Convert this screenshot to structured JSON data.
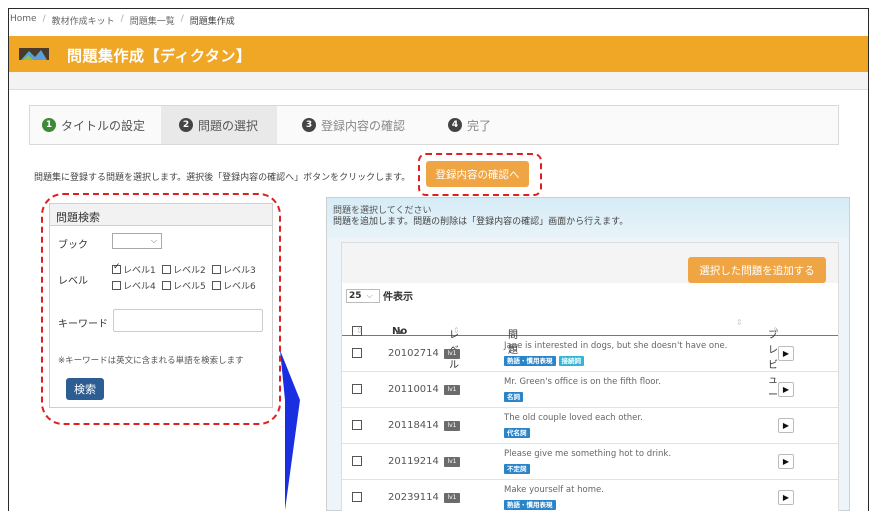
{
  "breadcrumb": [
    "Home",
    "教材作成キット",
    "問題集一覧",
    "問題集作成"
  ],
  "page_title": "問題集作成【ディクタン】",
  "steps": [
    {
      "num": "1",
      "label": "タイトルの設定"
    },
    {
      "num": "2",
      "label": "問題の選択"
    },
    {
      "num": "3",
      "label": "登録内容の確認"
    },
    {
      "num": "4",
      "label": "完了"
    }
  ],
  "instruction": "問題集に登録する問題を選択します。選択後「登録内容の確認へ」ボタンをクリックします。",
  "confirm_button": "登録内容の確認へ",
  "search": {
    "heading": "問題検索",
    "book_label": "ブック",
    "book_caret": "⌵",
    "level_label": "レベル",
    "levels": [
      "レベル1",
      "レベル2",
      "レベル3",
      "レベル4",
      "レベル5",
      "レベル6"
    ],
    "keyword_label": "キーワード",
    "note": "※キーワードは英文に含まれる単語を検索します",
    "button": "検索"
  },
  "right": {
    "line1": "問題を選択してください",
    "line2": "問題を追加します。問題の削除は「登録内容の確認」画面から行えます。",
    "add_button": "選択した問題を追加する",
    "per_page_value": "25",
    "per_page_caret": "⌵",
    "per_page_label": "件表示",
    "columns": {
      "no": "No",
      "level": "レベル",
      "question": "問題",
      "preview": "プレビュー"
    }
  },
  "rows": [
    {
      "no": "20102714",
      "level": "lv1",
      "question": "Jane is interested in dogs, but she doesn't have one.",
      "tags": [
        "熟語・慣用表現",
        "接続詞"
      ]
    },
    {
      "no": "20110014",
      "level": "lv1",
      "question": "Mr. Green's office is on the fifth floor.",
      "tags": [
        "名詞"
      ]
    },
    {
      "no": "20118414",
      "level": "lv1",
      "question": "The old couple loved each other.",
      "tags": [
        "代名詞"
      ]
    },
    {
      "no": "20119214",
      "level": "lv1",
      "question": "Please give me something hot to drink.",
      "tags": [
        "不定詞"
      ]
    },
    {
      "no": "20239114",
      "level": "lv1",
      "question": "Make yourself at home.",
      "tags": [
        "熟語・慣用表現"
      ]
    }
  ],
  "preview_glyph": "▶",
  "colors": {
    "brand": "#f0a725",
    "button_orange": "#f0a545",
    "search_blue": "#2c5d93",
    "annotation_red": "#e02020",
    "arrow_blue": "#1a2fe0"
  }
}
